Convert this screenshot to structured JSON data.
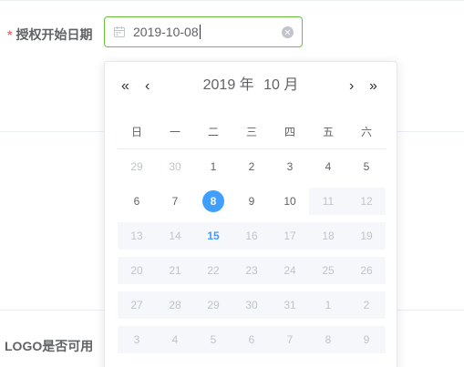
{
  "form": {
    "required_mark": "*",
    "auth_date_label": "授权开始日期",
    "logo_label": "LOGO是否可用"
  },
  "date_input": {
    "value": "2019-10-08",
    "focus_color": "#67c23a"
  },
  "picker": {
    "prev_year": "«",
    "prev_month": "‹",
    "next_month": "›",
    "next_year": "»",
    "year": "2019 年",
    "month": "10 月",
    "weekdays": [
      "日",
      "一",
      "二",
      "三",
      "四",
      "五",
      "六"
    ],
    "selected_color": "#409eff",
    "weeks": [
      [
        {
          "d": "29",
          "t": "prev"
        },
        {
          "d": "30",
          "t": "prev"
        },
        {
          "d": "1",
          "t": "normal"
        },
        {
          "d": "2",
          "t": "normal"
        },
        {
          "d": "3",
          "t": "normal"
        },
        {
          "d": "4",
          "t": "normal"
        },
        {
          "d": "5",
          "t": "normal"
        }
      ],
      [
        {
          "d": "6",
          "t": "normal"
        },
        {
          "d": "7",
          "t": "normal"
        },
        {
          "d": "8",
          "t": "selected"
        },
        {
          "d": "9",
          "t": "normal"
        },
        {
          "d": "10",
          "t": "normal"
        },
        {
          "d": "11",
          "t": "disabled"
        },
        {
          "d": "12",
          "t": "disabled"
        }
      ],
      [
        {
          "d": "13",
          "t": "disabled"
        },
        {
          "d": "14",
          "t": "disabled"
        },
        {
          "d": "15",
          "t": "today"
        },
        {
          "d": "16",
          "t": "disabled"
        },
        {
          "d": "17",
          "t": "disabled"
        },
        {
          "d": "18",
          "t": "disabled"
        },
        {
          "d": "19",
          "t": "disabled"
        }
      ],
      [
        {
          "d": "20",
          "t": "disabled"
        },
        {
          "d": "21",
          "t": "disabled"
        },
        {
          "d": "22",
          "t": "disabled"
        },
        {
          "d": "23",
          "t": "disabled"
        },
        {
          "d": "24",
          "t": "disabled"
        },
        {
          "d": "25",
          "t": "disabled"
        },
        {
          "d": "26",
          "t": "disabled"
        }
      ],
      [
        {
          "d": "27",
          "t": "disabled"
        },
        {
          "d": "28",
          "t": "disabled"
        },
        {
          "d": "29",
          "t": "disabled"
        },
        {
          "d": "30",
          "t": "disabled"
        },
        {
          "d": "31",
          "t": "disabled"
        },
        {
          "d": "1",
          "t": "next-disabled"
        },
        {
          "d": "2",
          "t": "next-disabled"
        }
      ],
      [
        {
          "d": "3",
          "t": "next-disabled"
        },
        {
          "d": "4",
          "t": "next-disabled"
        },
        {
          "d": "5",
          "t": "next-disabled"
        },
        {
          "d": "6",
          "t": "next-disabled"
        },
        {
          "d": "7",
          "t": "next-disabled"
        },
        {
          "d": "8",
          "t": "next-disabled"
        },
        {
          "d": "9",
          "t": "next-disabled"
        }
      ]
    ]
  }
}
